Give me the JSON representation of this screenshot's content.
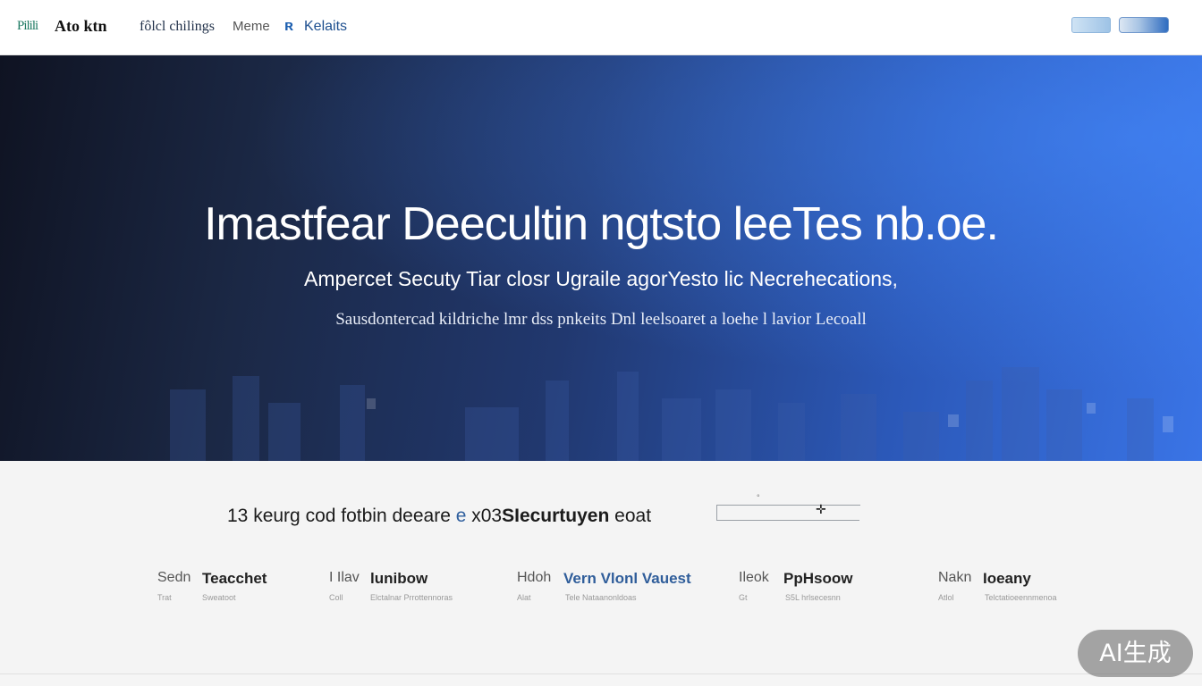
{
  "nav": {
    "logo_mark": "Pilili",
    "logo_text": "Ato ktn",
    "links": [
      "fôlcl chilings",
      "Meme",
      "Kelaits"
    ]
  },
  "hero": {
    "title": "Imastfear Deecultin ngtsto leeTes nb.oe.",
    "subtitle": "Ampercet Secuty Tiar closr Ugraile agorYesto lic Necrehecations,",
    "tagline": "Sausdontercad kildriche lmr dss pnkeits Dnl leelsoaret a loehe l lavior Lecoall"
  },
  "strip": {
    "headline_prefix": "13 keurg",
    "headline_mid": "cod fotbin deeare",
    "headline_sym": "e",
    "headline_num": "x03",
    "headline_bold": "SIecurtuyen",
    "headline_tail": "eoat",
    "features": [
      {
        "kicker": "Sedn",
        "title": "Teacchet",
        "small_left": "Trat",
        "small_right": "Sweatoot"
      },
      {
        "kicker": "I Ilav",
        "title": "lunibow",
        "small_left": "Coll",
        "small_right": "Elctalnar Prrottennoras"
      },
      {
        "kicker": "Hdoh",
        "title": "Vern Vlonl Vauest",
        "small_left": "Alat",
        "small_right": "Tele Nataanonldoas"
      },
      {
        "kicker": "Ileok",
        "title": "PpHsoow",
        "small_left": "Gt",
        "small_right": "S5L hrlsecesnn"
      },
      {
        "kicker": "Nakn",
        "title": "Ioeany",
        "small_left": "Atlol",
        "small_right": "Telctatioeennmenoa"
      }
    ]
  },
  "watermark": "AI生成",
  "colors": {
    "hero_dark": "#0f1322",
    "hero_blue": "#3a74e6",
    "accent_blue": "#2f5d9a"
  }
}
